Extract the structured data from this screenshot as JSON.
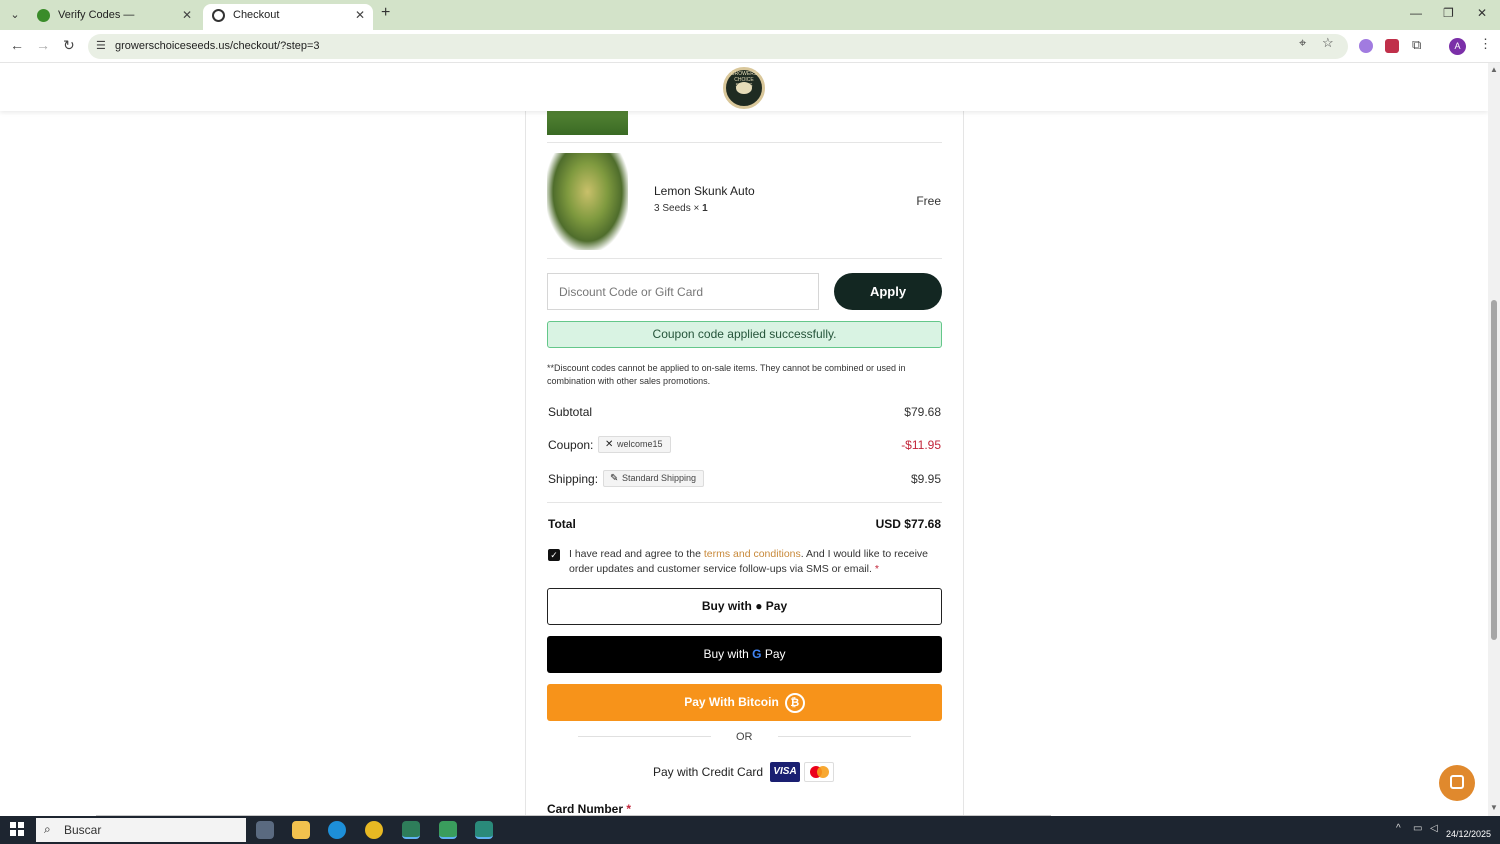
{
  "browser": {
    "tabs": [
      {
        "title": "Verify Codes — SimplyCodes",
        "active": false
      },
      {
        "title": "Checkout",
        "active": true
      }
    ],
    "url": "growerschoiceseeds.us/checkout/?step=3",
    "profile_initial": "A",
    "icons": {
      "tab_menu": "chevron-down-icon",
      "new_tab": "plus-icon",
      "back": "back-arrow-icon",
      "forward": "forward-arrow-icon",
      "reload": "reload-icon",
      "site_info": "tune-icon",
      "location": "location-pin-icon",
      "bookmark": "star-icon",
      "extensions": "puzzle-icon",
      "menu": "kebab-menu-icon"
    }
  },
  "site": {
    "logo_text": "GROWERS CHOICE SEEDS"
  },
  "order": {
    "items": [
      {
        "name": "Lemon Skunk Auto",
        "variant": "3 Seeds",
        "qty_prefix": " × ",
        "qty": "1",
        "price": "Free"
      }
    ],
    "discount_placeholder": "Discount Code or Gift Card",
    "apply_label": "Apply",
    "success_message": "Coupon code applied successfully.",
    "disclaimer": "**Discount codes cannot be applied to on-sale items. They cannot be combined or used in combination with other sales promotions.",
    "subtotal_label": "Subtotal",
    "subtotal_value": "$79.68",
    "coupon_label": "Coupon:",
    "coupon_code": "welcome15",
    "coupon_value": "-$11.95",
    "shipping_label": "Shipping:",
    "shipping_method": "Standard Shipping",
    "shipping_value": "$9.95",
    "total_label": "Total",
    "total_value": "USD $77.68",
    "agree_prefix": "I have read and agree to the ",
    "terms_link": "terms and conditions",
    "agree_suffix": ". And I would like to receive order updates and customer service follow-ups via SMS or email. ",
    "required_mark": "*",
    "agree_checked": true,
    "apple_pay_label": "Buy with ",
    "apple_pay_brand": " Pay",
    "google_pay_label": "Buy with ",
    "google_pay_g": "G",
    "google_pay_brand": " Pay",
    "bitcoin_label": "Pay With Bitcoin",
    "bitcoin_symbol": "₿",
    "or_label": "OR",
    "credit_card_label": "Pay with Credit Card",
    "visa_label": "VISA",
    "card_number_label": "Card Number",
    "card_required": " *"
  },
  "colors": {
    "apply_button": "#132722",
    "success_bg": "#d9f3e3",
    "coupon_discount": "#c2253a",
    "terms_link": "#c8893a",
    "bitcoin": "#f7931a",
    "chat_button": "#e0892d"
  },
  "taskbar": {
    "search_placeholder": "Buscar",
    "date": "24/12/2025"
  }
}
